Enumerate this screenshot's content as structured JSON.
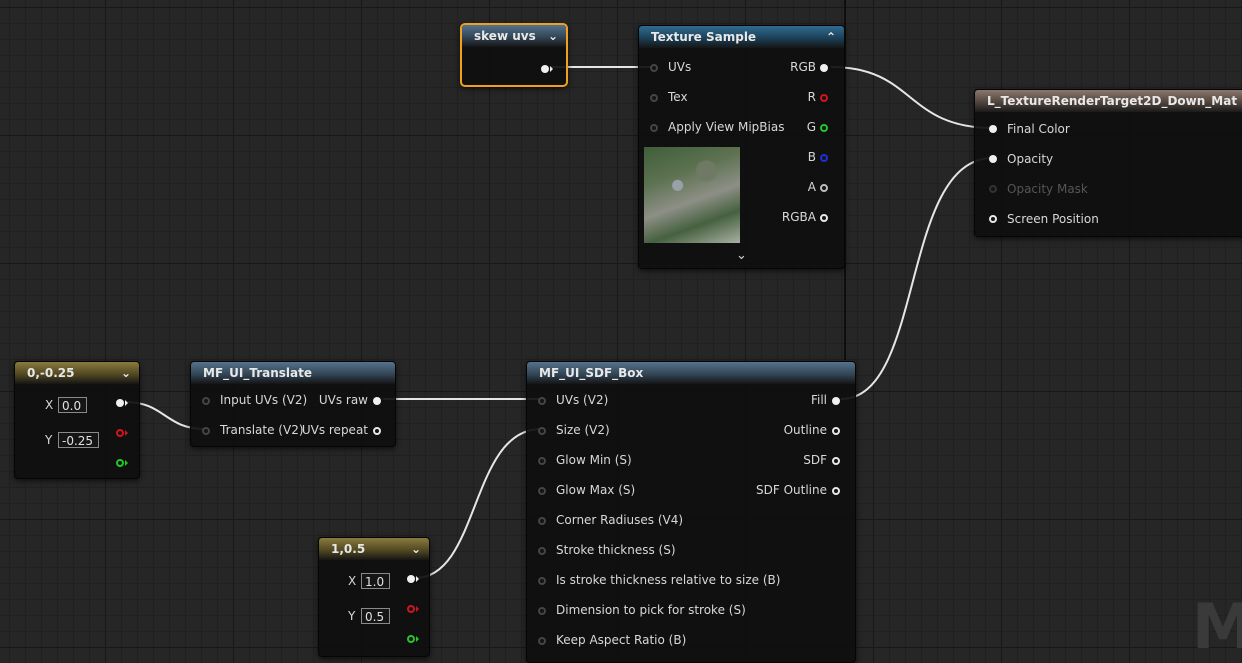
{
  "nodes": {
    "skew": {
      "title": "skew uvs"
    },
    "texture": {
      "title": "Texture Sample",
      "inputs": [
        "UVs",
        "Tex",
        "Apply View MipBias"
      ],
      "outputs": [
        "RGB",
        "R",
        "G",
        "B",
        "A",
        "RGBA"
      ]
    },
    "result": {
      "title": "L_TextureRenderTarget2D_Down_Mat",
      "inputs": [
        "Final Color",
        "Opacity",
        "Opacity Mask",
        "Screen Position"
      ]
    },
    "const_a": {
      "title": "0,-0.25",
      "x_label": "X",
      "x_value": "0.0",
      "y_label": "Y",
      "y_value": "-0.25"
    },
    "translate": {
      "title": "MF_UI_Translate",
      "inputs": [
        "Input UVs (V2)",
        "Translate (V2)"
      ],
      "outputs": [
        "UVs raw",
        "UVs repeat"
      ]
    },
    "sdf": {
      "title": "MF_UI_SDF_Box",
      "inputs": [
        "UVs (V2)",
        "Size (V2)",
        "Glow Min (S)",
        "Glow Max (S)",
        "Corner Radiuses (V4)",
        "Stroke thickness (S)",
        "Is stroke thickness relative to size (B)",
        "Dimension to pick for stroke (S)",
        "Keep Aspect Ratio (B)"
      ],
      "outputs": [
        "Fill",
        "Outline",
        "SDF",
        "SDF Outline"
      ]
    },
    "const_b": {
      "title": "1,0.5",
      "x_label": "X",
      "x_value": "1.0",
      "y_label": "Y",
      "y_value": "0.5"
    }
  },
  "watermark": "M",
  "colors": {
    "selection": "#f0a020",
    "red_pin": "#d2141e",
    "green_pin": "#26c626",
    "blue_pin": "#1c30d8"
  },
  "icons": [
    "chevron-down-icon",
    "chevron-up-icon",
    "pin-arrow-icon"
  ]
}
